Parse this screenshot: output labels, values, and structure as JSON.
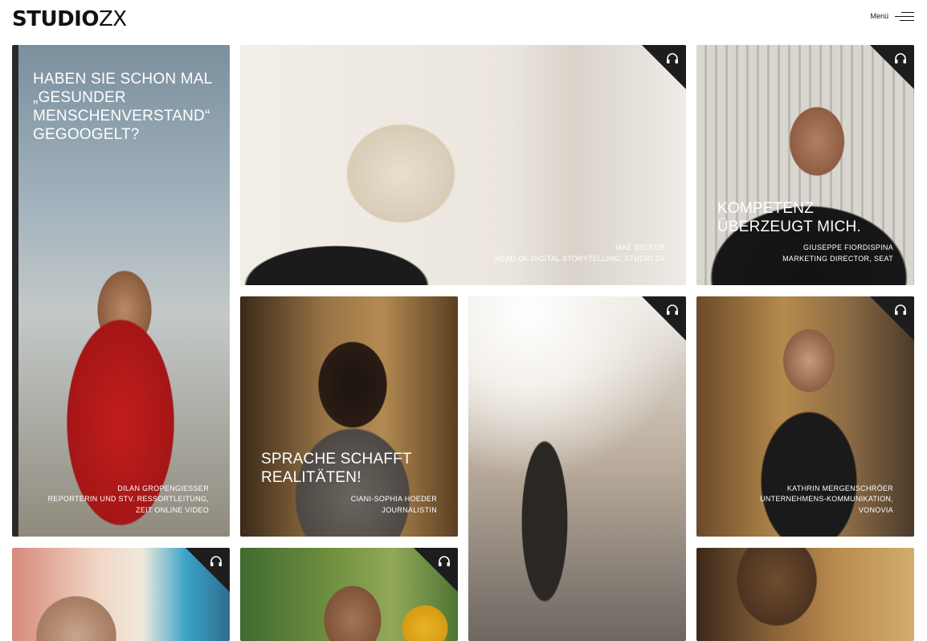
{
  "header": {
    "logo_left": "STUDIO",
    "logo_right": "ZX",
    "menu_label": "Menü"
  },
  "tiles": [
    {
      "quote": "HABEN SIE SCHON MAL „GESUNDER MENSCHENVERSTAND“ GEGOOGELT?",
      "quote_lines": [
        "HABEN SIE SCHON MAL",
        "„GESUNDER",
        "MENSCHENVERSTAND“",
        "GEGOOGELT?"
      ],
      "credit_lines": [
        "DILAN GROPENGIESSER",
        "REPORTERIN UND STV. RESSORTLEITUNG,",
        "ZEIT ONLINE VIDEO"
      ],
      "audio": false
    },
    {
      "credit_lines": [
        "MAE BECKER",
        "HEAD OF DIGITAL STORYTELLING, STUDIO ZX"
      ],
      "audio": true,
      "icon": "headphones-icon"
    },
    {
      "quote_lines": [
        "KOMPETENZ",
        "ÜBERZEUGT MICH."
      ],
      "credit_lines": [
        "GIUSEPPE FIORDISPINA",
        "MARKETING DIRECTOR, SEAT"
      ],
      "audio": true,
      "icon": "headphones-icon"
    },
    {
      "quote_lines": [
        "SPRACHE SCHAFFT",
        "REALITÄTEN!"
      ],
      "credit_lines": [
        "CIANI-SOPHIA HOEDER",
        "JOURNALISTIN"
      ],
      "audio": false
    },
    {
      "audio": true,
      "icon": "headphones-icon"
    },
    {
      "credit_lines": [
        "KATHRIN MERGENSCHRÖER",
        "UNTERNEHMENS-KOMMUNIKATION,",
        "VONOVIA"
      ],
      "audio": true,
      "icon": "headphones-icon"
    },
    {
      "audio": true,
      "icon": "headphones-icon"
    },
    {
      "audio": true,
      "icon": "headphones-icon"
    },
    {
      "audio": false
    }
  ]
}
